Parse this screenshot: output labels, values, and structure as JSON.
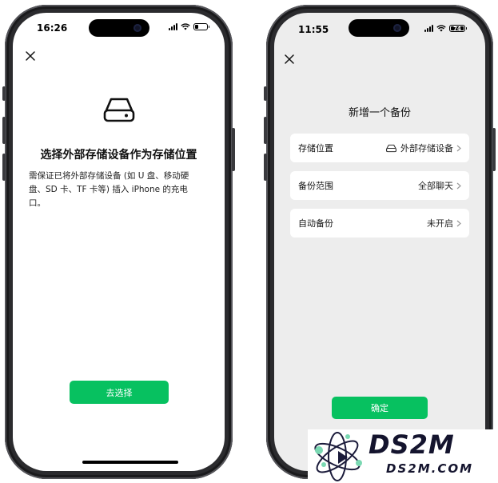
{
  "left_phone": {
    "status_time": "16:26",
    "title": "选择外部存储设备作为存储位置",
    "description_line1": "需保证已将外部存储设备 (如 U 盘、移动硬",
    "description_line2": "盘、SD 卡、TF 卡等) 插入 iPhone 的充电",
    "description_line3": "口。",
    "button_label": "去选择",
    "icons": {
      "close": "close-icon",
      "storage": "external-drive-icon"
    }
  },
  "right_phone": {
    "status_time": "11:55",
    "battery_level": "74",
    "title": "新增一个备份",
    "rows": [
      {
        "label": "存储位置",
        "value": "外部存储设备",
        "icon": "external-drive-icon"
      },
      {
        "label": "备份范围",
        "value": "全部聊天"
      },
      {
        "label": "自动备份",
        "value": "未开启"
      }
    ],
    "button_label": "确定"
  },
  "watermark": {
    "brand": "DS2M",
    "url": "DS2M.COM"
  },
  "colors": {
    "accent_green": "#07c160",
    "frame": "#2b2b2e",
    "screen_bg_right": "#ededed"
  }
}
